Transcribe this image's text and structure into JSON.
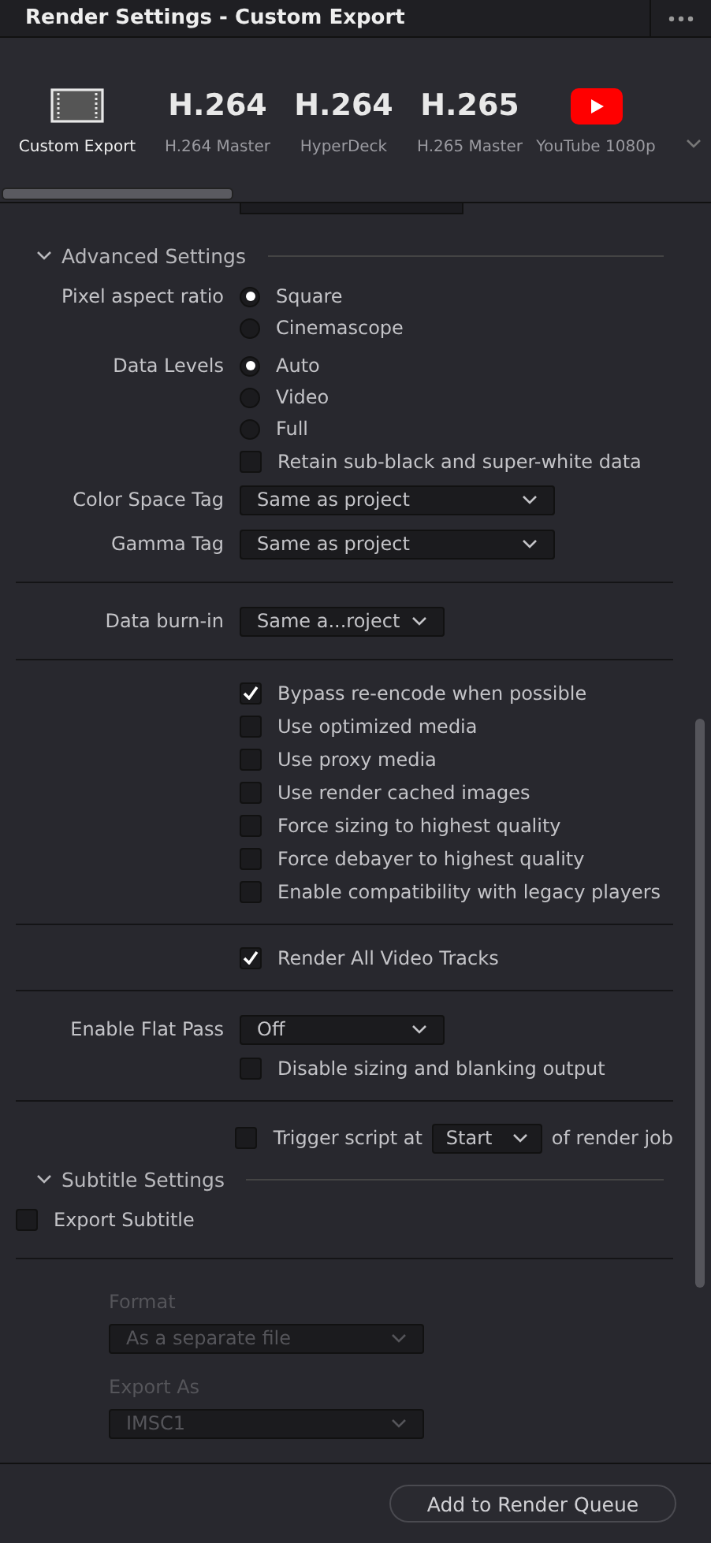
{
  "window": {
    "title": "Render Settings - Custom Export"
  },
  "presets": [
    {
      "kind": "film",
      "label": "Custom Export",
      "selected": true
    },
    {
      "kind": "codec",
      "codec": "H.264",
      "label": "H.264 Master",
      "selected": false
    },
    {
      "kind": "codec",
      "codec": "H.264",
      "label": "HyperDeck",
      "selected": false
    },
    {
      "kind": "codec",
      "codec": "H.265",
      "label": "H.265 Master",
      "selected": false
    },
    {
      "kind": "youtube",
      "label": "YouTube 1080p",
      "selected": false
    }
  ],
  "rows": [
    {
      "kind": "header",
      "label": "Advanced Settings",
      "expanded": true
    },
    {
      "kind": "radio",
      "label": "Pixel aspect ratio",
      "options": [
        {
          "label": "Square",
          "selected": true
        },
        {
          "label": "Cinemascope",
          "selected": false
        }
      ]
    },
    {
      "kind": "radio",
      "label": "Data Levels",
      "options": [
        {
          "label": "Auto",
          "selected": true
        },
        {
          "label": "Video",
          "selected": false
        },
        {
          "label": "Full",
          "selected": false
        }
      ]
    },
    {
      "kind": "checkbox",
      "label": "Retain sub-black and super-white data",
      "checked": false
    },
    {
      "kind": "wide-dropdown",
      "label": "Color Space Tag",
      "value": "Same as project"
    },
    {
      "kind": "wide-dropdown",
      "label": "Gamma Tag",
      "value": "Same as project"
    },
    {
      "kind": "divider"
    },
    {
      "kind": "short-dropdown",
      "label": "Data burn-in",
      "value": "Same a...roject"
    },
    {
      "kind": "divider"
    },
    {
      "kind": "checkbox",
      "label": "Bypass re-encode when possible",
      "checked": true
    },
    {
      "kind": "checkbox",
      "label": "Use optimized media",
      "checked": false
    },
    {
      "kind": "checkbox",
      "label": "Use proxy media",
      "checked": false
    },
    {
      "kind": "checkbox",
      "label": "Use render cached images",
      "checked": false
    },
    {
      "kind": "checkbox",
      "label": "Force sizing to highest quality",
      "checked": false
    },
    {
      "kind": "checkbox",
      "label": "Force debayer to highest quality",
      "checked": false
    },
    {
      "kind": "checkbox",
      "label": "Enable compatibility with legacy players",
      "checked": false
    },
    {
      "kind": "divider"
    },
    {
      "kind": "checkbox",
      "label": "Render All Video Tracks",
      "checked": true
    },
    {
      "kind": "divider"
    },
    {
      "kind": "short-dropdown",
      "label": "Enable Flat Pass",
      "value": "Off"
    },
    {
      "kind": "checkbox",
      "label": "Disable sizing and blanking output",
      "checked": false
    },
    {
      "kind": "divider"
    },
    {
      "kind": "trigger",
      "label": "Trigger script at",
      "value": "Start",
      "suffix": "of render job",
      "checked": false
    },
    {
      "kind": "header",
      "label": "Subtitle Settings",
      "expanded": true
    },
    {
      "kind": "left-checkbox",
      "label": "Export Subtitle",
      "checked": false
    },
    {
      "kind": "divider"
    },
    {
      "kind": "field-label",
      "label": "Format",
      "disabled": true
    },
    {
      "kind": "field-dropdown",
      "value": "As a separate file",
      "disabled": true
    },
    {
      "kind": "field-label",
      "label": "Export As",
      "disabled": true
    },
    {
      "kind": "field-dropdown",
      "value": "IMSC1",
      "disabled": true
    }
  ],
  "footer": {
    "button": "Add to Render Queue"
  }
}
